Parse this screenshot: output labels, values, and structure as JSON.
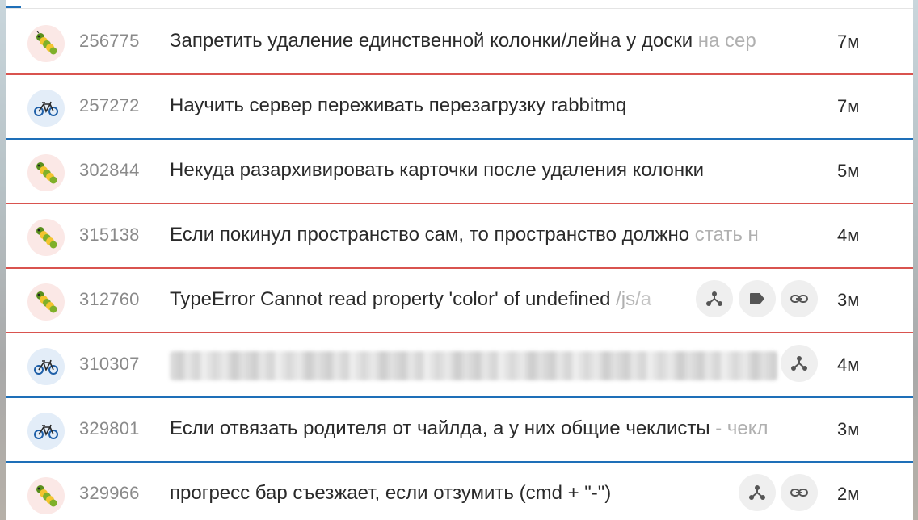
{
  "rows": [
    {
      "type": "bug",
      "avatar": "caterpillar-icon",
      "number": "256775",
      "title": "Запретить удаление единственной колонки/лейна у доски ",
      "title_tail": "на сер",
      "time": "7м"
    },
    {
      "type": "feature",
      "avatar": "bicycle-icon",
      "number": "257272",
      "title": "Научить сервер переживать перезагрузку rabbitmq",
      "title_tail": "",
      "time": "7м"
    },
    {
      "type": "bug",
      "avatar": "caterpillar-icon",
      "number": "302844",
      "title": "Некуда разархивировать карточки после удаления колонки",
      "title_tail": "",
      "time": "5м"
    },
    {
      "type": "bug",
      "avatar": "caterpillar-icon",
      "number": "315138",
      "title": "Если покинул пространство сам, то пространство должно ",
      "title_tail": "стать н",
      "time": "4м"
    },
    {
      "type": "bug",
      "avatar": "caterpillar-icon",
      "number": "312760",
      "title": "TypeError Cannot read property 'color' of undefined ",
      "title_tail": "/js/a",
      "time": "3м",
      "actions": [
        "hierarchy-icon",
        "tag-icon",
        "link-icon"
      ]
    },
    {
      "type": "feature",
      "avatar": "bicycle-icon",
      "number": "310307",
      "title": "",
      "title_tail": "",
      "time": "4м",
      "blurred": true,
      "actions": [
        "hierarchy-icon"
      ]
    },
    {
      "type": "feature",
      "avatar": "bicycle-icon",
      "number": "329801",
      "title": "Если отвязать родителя от чайлда, а у них общие чеклисты ",
      "title_tail": "- чекл",
      "time": "3м"
    },
    {
      "type": "bug",
      "avatar": "caterpillar-icon",
      "number": "329966",
      "title": "прогресс бар съезжает, если отзумить (cmd + \"-\")",
      "title_tail": "",
      "time": "2м",
      "actions": [
        "hierarchy-icon",
        "link-icon"
      ]
    }
  ],
  "colors": {
    "bug_line": "#d9534f",
    "feature_line": "#1e6fb8"
  }
}
